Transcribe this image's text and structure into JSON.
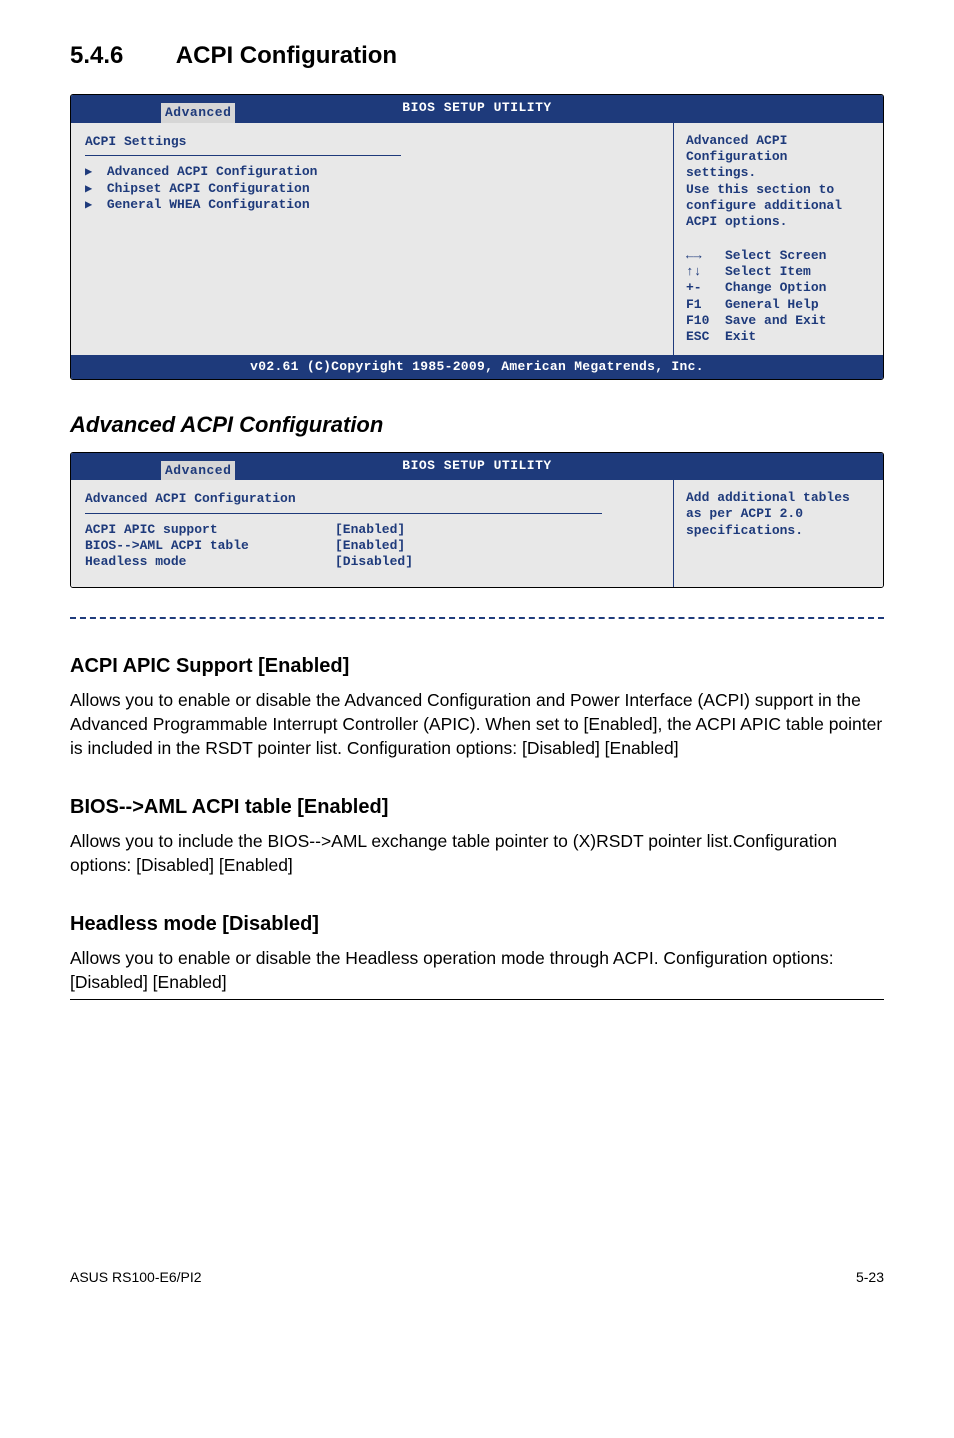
{
  "section": {
    "number": "5.4.6",
    "title": "ACPI Configuration"
  },
  "bios1": {
    "header": "BIOS SETUP UTILITY",
    "tab": "Advanced",
    "left_title": "ACPI Settings",
    "items": [
      "Advanced ACPI Configuration",
      "Chipset ACPI Configuration",
      "General WHEA Configuration"
    ],
    "help": [
      "Advanced ACPI",
      "Configuration",
      "settings.",
      "",
      "Use this section to",
      "configure additional",
      "ACPI options."
    ],
    "nav": [
      "←→   Select Screen",
      "↑↓   Select Item",
      "+-   Change Option",
      "F1   General Help",
      "F10  Save and Exit",
      "ESC  Exit"
    ],
    "footer": "v02.61 (C)Copyright 1985-2009, American Megatrends, Inc."
  },
  "sub_title": "Advanced ACPI Configuration",
  "bios2": {
    "header": "BIOS SETUP UTILITY",
    "tab": "Advanced",
    "left_title": "Advanced ACPI Configuration",
    "rows": [
      {
        "label": "ACPI APIC support",
        "value": "[Enabled]"
      },
      {
        "label": "BIOS-->AML ACPI table",
        "value": "[Enabled]"
      },
      {
        "label": "Headless mode",
        "value": "[Disabled]"
      }
    ],
    "help": [
      "Add additional tables",
      "as per ACPI 2.0",
      "specifications."
    ]
  },
  "options": [
    {
      "title": "ACPI APIC Support [Enabled]",
      "body": "Allows you to enable or disable the Advanced Configuration and Power Interface (ACPI) support in the Advanced Programmable Interrupt Controller (APIC). When set to [Enabled], the ACPI APIC table pointer is included in the RSDT pointer list. Configuration options: [Disabled] [Enabled]"
    },
    {
      "title": "BIOS-->AML ACPI table [Enabled]",
      "body": "Allows you to include the BIOS-->AML exchange table pointer to (X)RSDT pointer list.Configuration options: [Disabled] [Enabled]"
    },
    {
      "title": "Headless mode [Disabled]",
      "body": "Allows you to enable or disable the Headless operation mode through ACPI. Configuration options: [Disabled] [Enabled]"
    }
  ],
  "footer": {
    "left": "ASUS RS100-E6/PI2",
    "right": "5-23"
  }
}
